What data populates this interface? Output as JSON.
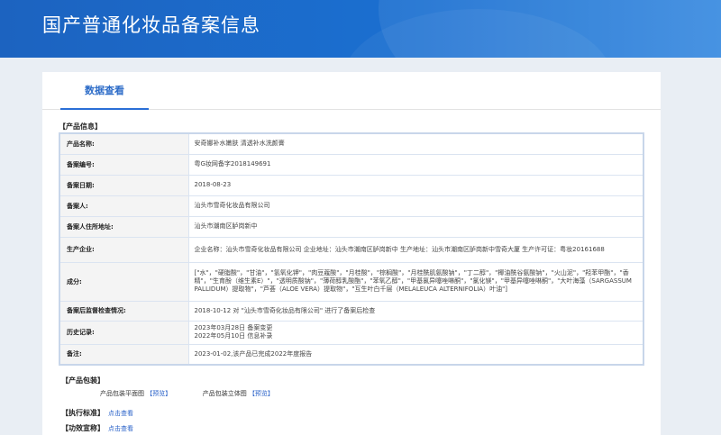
{
  "header": {
    "site_title": "国产普通化妆品备案信息"
  },
  "tabs": [
    {
      "label": "数据查看",
      "active": true
    }
  ],
  "product_info": {
    "section_title": "【产品信息】",
    "rows": [
      {
        "label": "产品名称:",
        "value": "安奇娜补水嫩肤 清透补水洗颜膏"
      },
      {
        "label": "备案编号:",
        "value": "粤G妆网备字2018149691"
      },
      {
        "label": "备案日期:",
        "value": "2018-08-23"
      },
      {
        "label": "备案人:",
        "value": "汕头市雪奇化妆品有限公司"
      },
      {
        "label": "备案人住所地址:",
        "value": "汕头市潮南区胪岗新中"
      },
      {
        "label": "生产企业:",
        "value": "企业名称：汕头市雪奇化妆品有限公司 企业地址：汕头市潮南区胪岗新中 生产地址：汕头市潮南区胪岗新中雪奇大厦 生产许可证：粤妆20161688"
      },
      {
        "label": "成分:",
        "value": "[\"水\"，\"硬脂酸\"，\"甘油\"，\"氢氧化钾\"，\"肉豆蔻酸\"，\"月桂酸\"，\"棕榈酸\"，\"月桂酰肌氨酸钠\"，\"丁二醇\"，\"椰油酰谷氨酸钠\"，\"火山泥\"，\"羟苯甲酯\"，\"香精\"，\"生育酚（维生素E）\"，\"透明质酸钠\"，\"薄荷醇乳酸酯\"，\"苯氧乙醇\"，\"甲基氯异噻唑啉酮\"，\"氯化镁\"，\"甲基异噻唑啉酮\"，\"大叶海藻（SARGASSUM PALLIDUM）提取物\"，\"芦荟（ALOE VERA）提取物\"，\"互生叶白千层（MELALEUCA ALTERNIFOLIA）叶油\"]"
      },
      {
        "label": "备案后监督检查情况:",
        "value": "2018-10-12 对 \"汕头市雪奇化妆品有限公司\" 进行了备案后检查"
      },
      {
        "label": "历史记录:",
        "value_lines": [
          "2023年03月28日 备案变更",
          "2022年05月10日 信息补录"
        ]
      },
      {
        "label": "备注:",
        "value": "2023-01-02,该产品已完成2022年度报告"
      }
    ]
  },
  "packaging": {
    "section_title": "【产品包装】",
    "flat_label": "产品包装平面图",
    "flat_link": "【预览】",
    "stereo_label": "产品包装立体图",
    "stereo_link": "【预览】"
  },
  "standard": {
    "label": "【执行标准】",
    "link": "点击查看"
  },
  "efficacy": {
    "label": "【功效宣称】",
    "link": "点击查看"
  }
}
